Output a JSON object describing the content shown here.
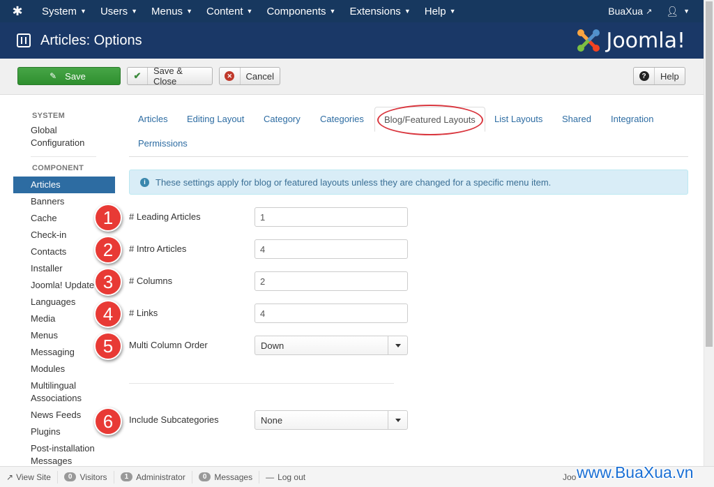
{
  "topnav": {
    "menus": [
      "System",
      "Users",
      "Menus",
      "Content",
      "Components",
      "Extensions",
      "Help"
    ],
    "site_name": "BuaXua",
    "logo_icon": "joomla-icon",
    "user_icon": "user-icon"
  },
  "header": {
    "title": "Articles: Options",
    "brand": "Joomla!"
  },
  "toolbar": {
    "save_label": "Save",
    "save_close_label": "Save & Close",
    "cancel_label": "Cancel",
    "help_label": "Help"
  },
  "sidebar": {
    "system_heading": "SYSTEM",
    "global_config": [
      "Global",
      "Configuration"
    ],
    "component_heading": "COMPONENT",
    "items": [
      "Articles",
      "Banners",
      "Cache",
      "Check-in",
      "Contacts",
      "Installer",
      "Joomla! Update",
      "Languages",
      "Media",
      "Menus",
      "Messaging",
      "Modules",
      "Multilingual Associations",
      "News Feeds",
      "Plugins",
      "Post-installation Messages"
    ],
    "active": "Articles"
  },
  "tabs": [
    "Articles",
    "Editing Layout",
    "Category",
    "Categories",
    "Blog/Featured Layouts",
    "List Layouts",
    "Shared",
    "Integration",
    "Permissions"
  ],
  "active_tab": "Blog/Featured Layouts",
  "alert": "These settings apply for blog or featured layouts unless they are changed for a specific menu item.",
  "form": {
    "leading_label": "# Leading Articles",
    "leading_value": "1",
    "intro_label": "# Intro Articles",
    "intro_value": "4",
    "columns_label": "# Columns",
    "columns_value": "2",
    "links_label": "# Links",
    "links_value": "4",
    "multi_label": "Multi Column Order",
    "multi_value": "Down",
    "subcat_label": "Include Subcategories",
    "subcat_value": "None"
  },
  "annotations": [
    "1",
    "2",
    "3",
    "4",
    "5",
    "6"
  ],
  "statusbar": {
    "view_site": "View Site",
    "visitors_count": "0",
    "visitors": "Visitors",
    "admin_count": "1",
    "admin": "Administrator",
    "messages_count": "0",
    "messages": "Messages",
    "logout": "Log out",
    "copyright": "Joo"
  },
  "watermark": "www.BuaXua.vn",
  "colors": {
    "nav_bg": "#17385f",
    "header_bg": "#1a3867",
    "save_green": "#46a546",
    "link_blue": "#2d6ca2",
    "annotation_red": "#e83a35"
  }
}
